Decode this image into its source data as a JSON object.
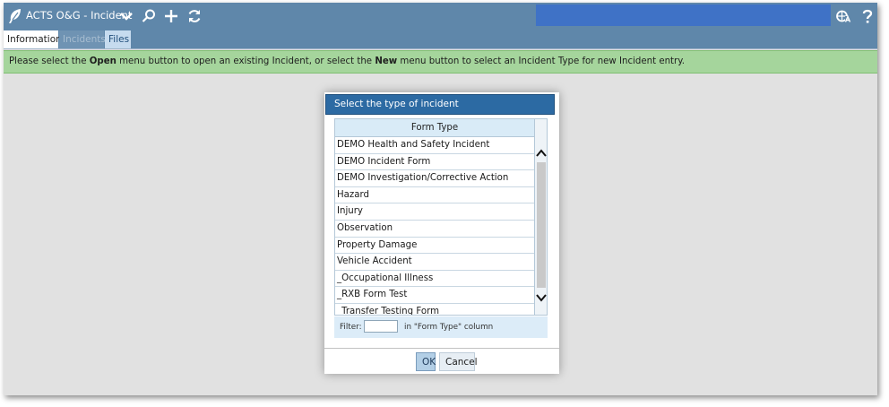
{
  "app": {
    "title": "ACTS O&G - Incident",
    "icons": [
      "leaf-logo-icon",
      "chevron-down-icon",
      "search-icon",
      "plus-icon",
      "refresh-icon",
      "translate-icon",
      "help-icon"
    ],
    "accent_color": "#5f87aa"
  },
  "tabs": [
    {
      "label": "Information",
      "state": "active"
    },
    {
      "label": "Incidents",
      "state": "disabled"
    },
    {
      "label": "Files",
      "state": "normal"
    }
  ],
  "message": {
    "part1": "Please select the ",
    "bold1": "Open",
    "part2": " menu button to open an existing Incident, or select the ",
    "bold2": "New",
    "part3": " menu button to select an Incident Type for new Incident entry.",
    "color": "#a5d59c"
  },
  "dialog": {
    "title": "Select the type of incident",
    "column_header": "Form Type",
    "items": [
      "DEMO Health and Safety Incident",
      "DEMO Incident Form",
      "DEMO Investigation/Corrective Action",
      "Hazard",
      "Injury",
      "Observation",
      "Property Damage",
      "Vehicle Accident",
      "_Occupational Illness",
      "_RXB Form Test",
      "_Transfer Testing Form"
    ],
    "filter": {
      "label": "Filter:",
      "value": "",
      "suffix": "in \"Form Type\" column"
    },
    "ok_label": "OK",
    "cancel_label": "Cancel"
  }
}
